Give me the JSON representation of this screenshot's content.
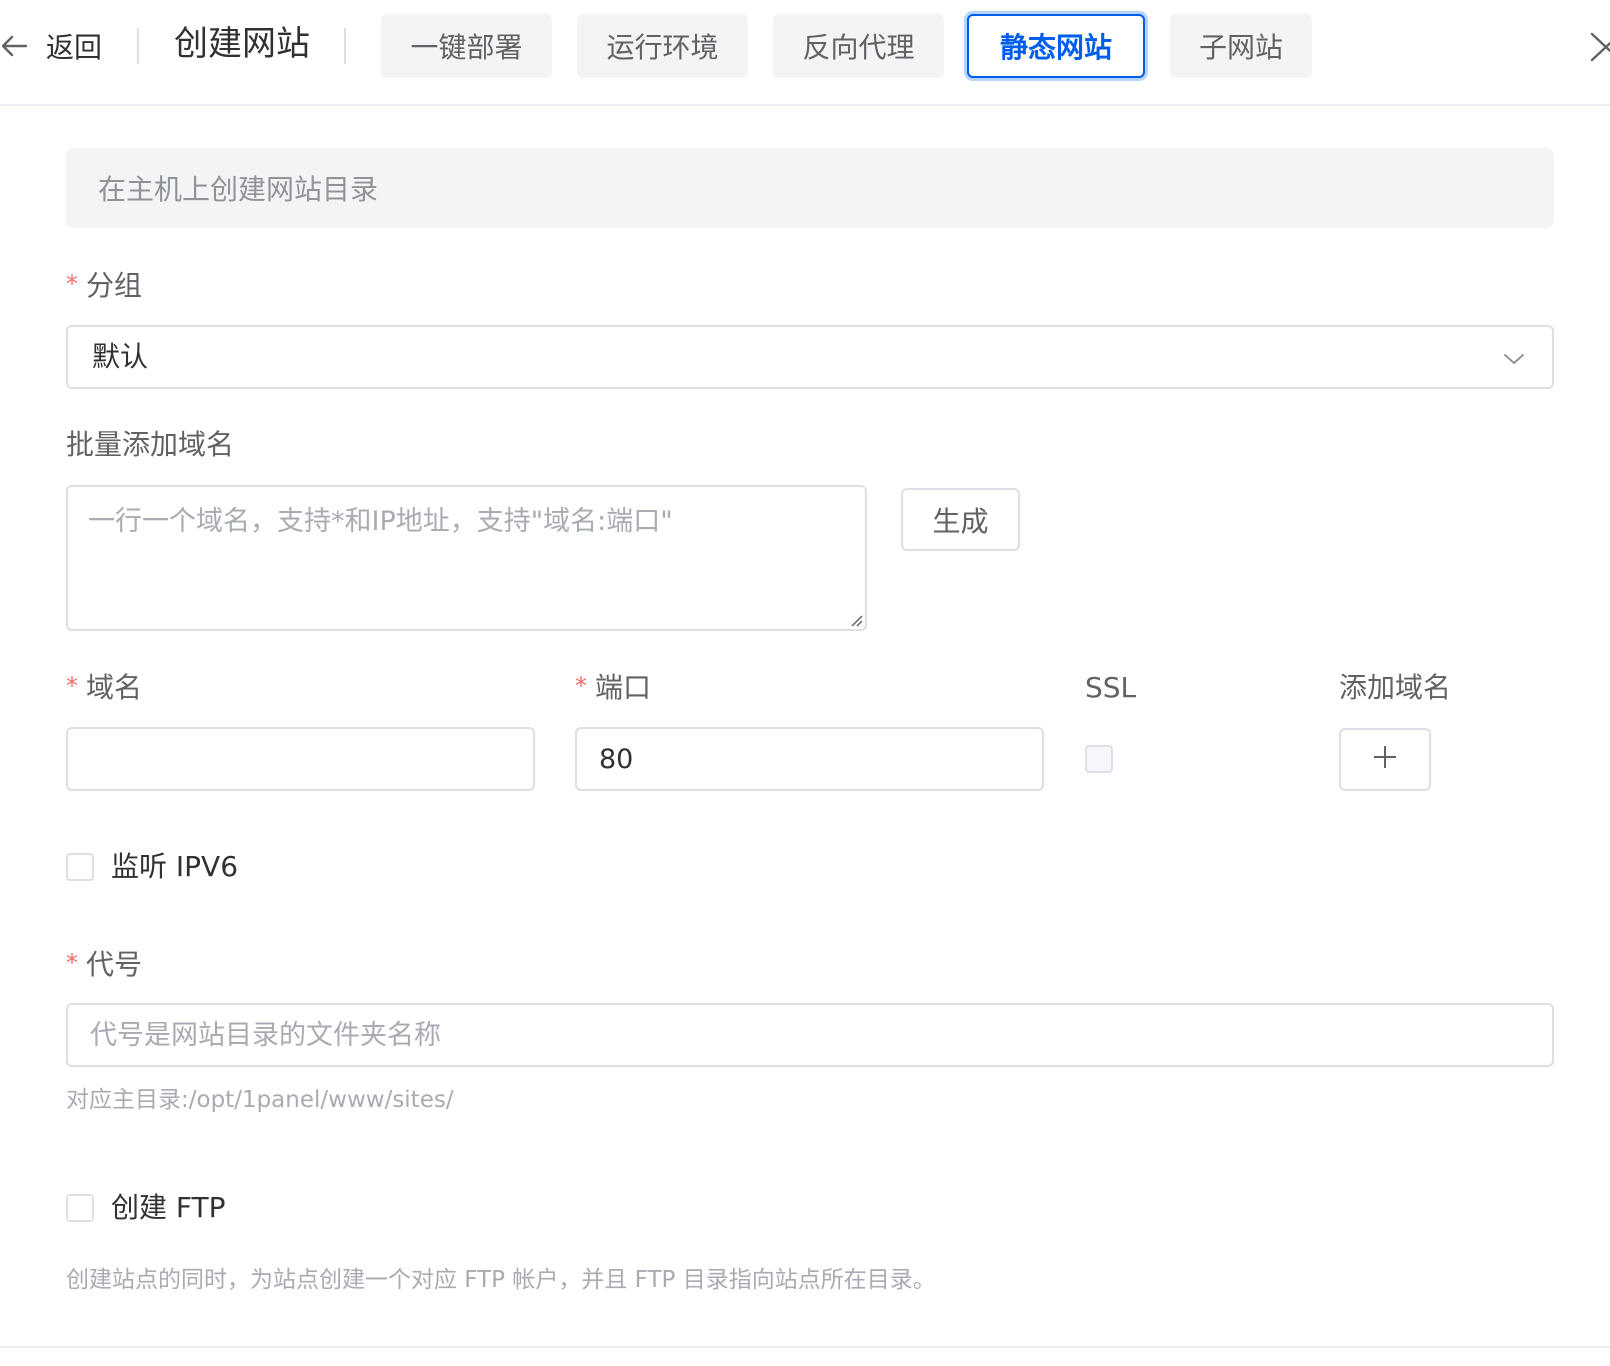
{
  "header": {
    "back_label": "返回",
    "title": "创建网站",
    "tabs": [
      {
        "label": "一键部署",
        "active": false
      },
      {
        "label": "运行环境",
        "active": false
      },
      {
        "label": "反向代理",
        "active": false
      },
      {
        "label": "静态网站",
        "active": true
      },
      {
        "label": "子网站",
        "active": false
      }
    ],
    "active_color": "#005eeb"
  },
  "notice": "在主机上创建网站目录",
  "group": {
    "label": "分组",
    "required_mark": "*",
    "value": "默认"
  },
  "batch_domains": {
    "label": "批量添加域名",
    "placeholder": "一行一个域名，支持*和IP地址，支持\"域名:端口\"",
    "generate_button": "生成"
  },
  "domain_row": {
    "domain_label": "域名",
    "domain_value": "",
    "port_label": "端口",
    "port_value": "80",
    "ssl_label": "SSL",
    "ssl_checked": false,
    "add_label": "添加域名",
    "add_button": "+"
  },
  "ipv6": {
    "label": "监听 IPV6",
    "checked": false
  },
  "alias": {
    "label": "代号",
    "placeholder": "代号是网站目录的文件夹名称",
    "hint": "对应主目录:/opt/1panel/www/sites/"
  },
  "ftp": {
    "label": "创建 FTP",
    "checked": false,
    "hint": "创建站点的同时，为站点创建一个对应 FTP 帐户，并且 FTP 目录指向站点所在目录。"
  },
  "required_color": "#f56c6c"
}
